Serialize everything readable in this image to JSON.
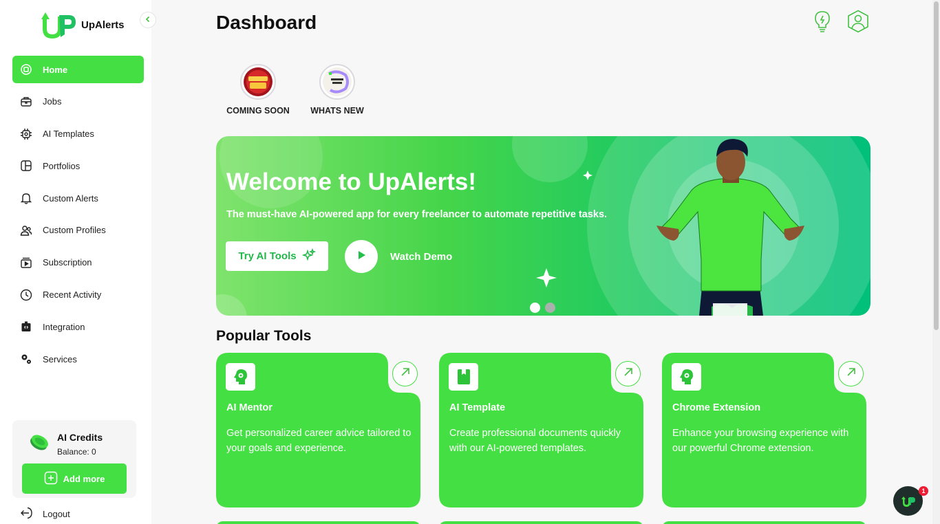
{
  "brand": {
    "name": "UpAlerts",
    "accent": "#44e043"
  },
  "sidebar": {
    "items": [
      {
        "label": "Home",
        "icon": "home-icon",
        "active": true
      },
      {
        "label": "Jobs",
        "icon": "briefcase-icon"
      },
      {
        "label": "AI Templates",
        "icon": "ai-chip-icon"
      },
      {
        "label": "Portfolios",
        "icon": "portfolio-grid-icon"
      },
      {
        "label": "Custom Alerts",
        "icon": "bell-icon"
      },
      {
        "label": "Custom Profiles",
        "icon": "users-icon"
      },
      {
        "label": "Subscription",
        "icon": "subscription-icon"
      },
      {
        "label": "Recent Activity",
        "icon": "clock-icon"
      },
      {
        "label": "Integration",
        "icon": "integration-icon"
      },
      {
        "label": "Services",
        "icon": "gears-icon"
      }
    ],
    "credits": {
      "title": "AI Credits",
      "balance": "Balance: 0",
      "add_label": "Add more"
    },
    "logout_label": "Logout"
  },
  "header": {
    "title": "Dashboard"
  },
  "stories": [
    {
      "label": "COMING SOON"
    },
    {
      "label": "WHATS NEW"
    }
  ],
  "banner": {
    "title": "Welcome to UpAlerts!",
    "subtitle": "The must-have AI-powered app for every freelancer to automate repetitive tasks.",
    "try_label": "Try AI Tools",
    "watch_label": "Watch Demo",
    "slides_total": 2,
    "slide_active": 1
  },
  "popular": {
    "title": "Popular Tools",
    "tools": [
      {
        "title": "AI Mentor",
        "desc": "Get personalized career advice tailored to your goals and experience.",
        "icon": "head-gear-icon"
      },
      {
        "title": "AI Template",
        "desc": "Create professional documents quickly with our AI-powered templates.",
        "icon": "bookmark-doc-icon"
      },
      {
        "title": "Chrome Extension",
        "desc": "Enhance your browsing experience with our powerful Chrome extension.",
        "icon": "head-gear-icon"
      }
    ]
  },
  "chat": {
    "badge": "1"
  }
}
